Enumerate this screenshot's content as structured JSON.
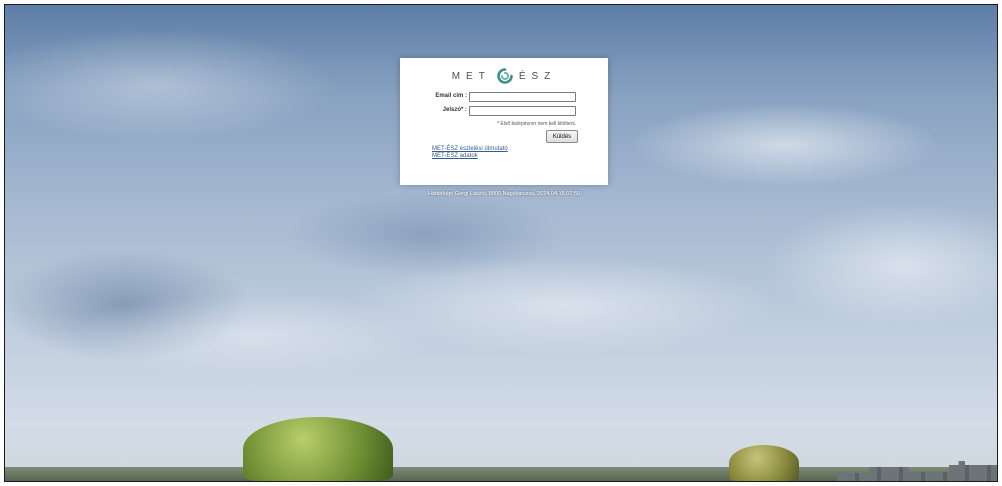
{
  "logo": {
    "left_text": "MET",
    "right_text": "ÉSZ",
    "mark_icon": "swirl-icon",
    "mark_color": "#3f8f8a"
  },
  "form": {
    "email_label": "Email cím :",
    "email_value": "",
    "password_label": "Jelszó* :",
    "password_value": "",
    "hint": "* Első belépésnor nem kell kitölteni.",
    "submit_label": "Küldés"
  },
  "links": [
    {
      "label": "MET-ÉSZ észlelési útmutató"
    },
    {
      "label": "MET-ÉSZ adatok"
    }
  ],
  "background_credit": "Háttérkép: Gergi László, 8800 Nagykanizsa, 2024.04.15 07:50",
  "colors": {
    "link": "#355a8c",
    "sky_top": "#5e7ea6",
    "sky_bottom": "#d3dce7"
  }
}
